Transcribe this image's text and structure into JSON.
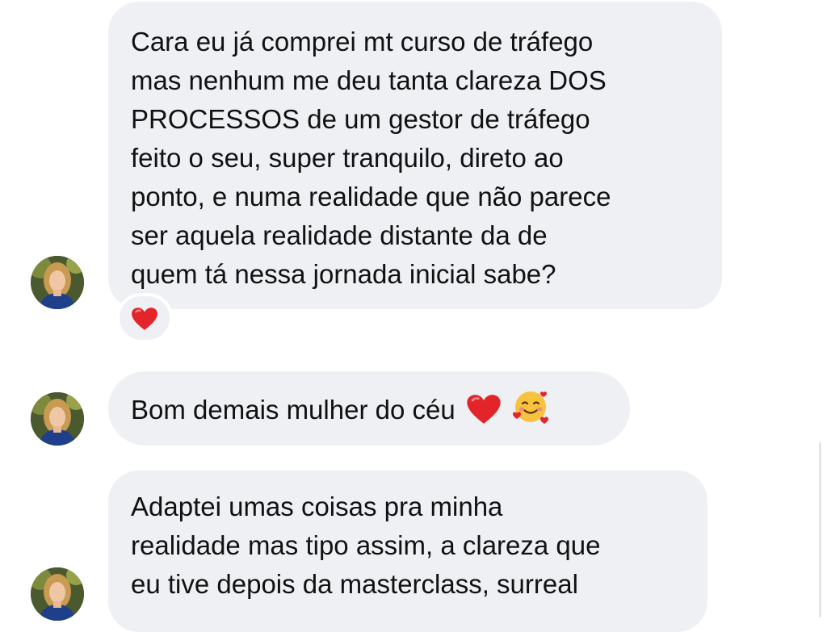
{
  "messages": [
    {
      "lines": [
        "Cara eu já comprei mt curso de tráfego",
        "mas nenhum me deu tanta clareza DOS",
        "PROCESSOS de um gestor de tráfego",
        "feito o seu, super tranquilo, direto ao",
        "ponto, e numa realidade que não parece",
        "ser aquela realidade distante da de",
        "quem tá nessa jornada inicial sabe?"
      ],
      "reaction": "heart"
    },
    {
      "text": "Bom demais mulher do céu",
      "emojis": [
        "heart",
        "smiling-face-with-hearts"
      ]
    },
    {
      "lines": [
        "Adaptei umas coisas pra minha",
        "realidade mas tipo assim, a clareza que",
        "eu tive depois da masterclass, surreal"
      ]
    }
  ],
  "colors": {
    "bubble_bg": "#eff0f4",
    "text": "#111111",
    "heart": "#e3242b"
  }
}
